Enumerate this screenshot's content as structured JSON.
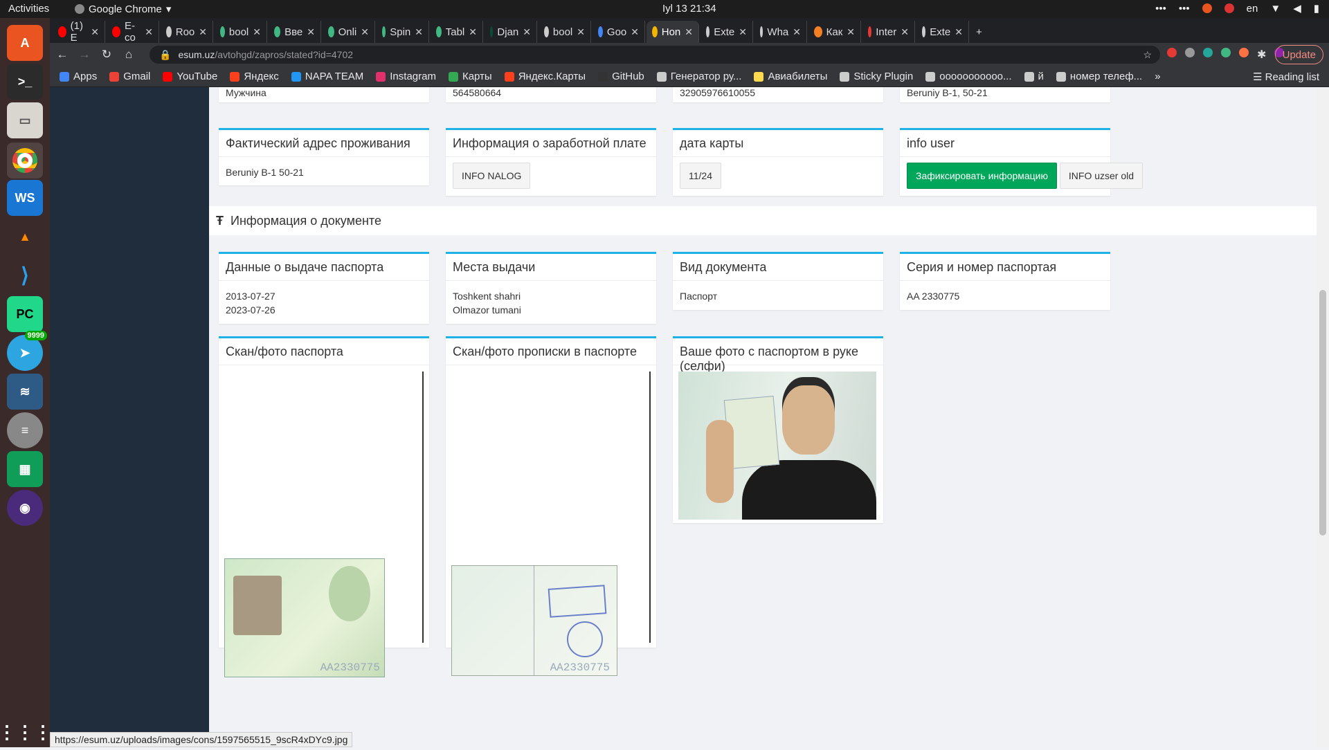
{
  "topbar": {
    "activities": "Activities",
    "app": "Google Chrome",
    "clock": "Iyl 13  21:34",
    "lang": "en"
  },
  "tabs": [
    {
      "label": "(1) E",
      "color": "#ff0000"
    },
    {
      "label": "E-co",
      "color": "#ff0000"
    },
    {
      "label": "Roo",
      "color": "#cccccc"
    },
    {
      "label": "bool",
      "color": "#41b883"
    },
    {
      "label": "Вве",
      "color": "#41b883"
    },
    {
      "label": "Onli",
      "color": "#41b883"
    },
    {
      "label": "Spin",
      "color": "#41b883"
    },
    {
      "label": "Tabl",
      "color": "#41b883"
    },
    {
      "label": "Djan",
      "color": "#0c4b33"
    },
    {
      "label": "bool",
      "color": "#cccccc"
    },
    {
      "label": "Goo",
      "color": "#4285f4"
    },
    {
      "label": "Hon",
      "color": "#f4b400"
    },
    {
      "label": "Exte",
      "color": "#cccccc"
    },
    {
      "label": "Wha",
      "color": "#cccccc"
    },
    {
      "label": "Как",
      "color": "#f48024"
    },
    {
      "label": "Inter",
      "color": "#e53935"
    },
    {
      "label": "Exte",
      "color": "#cccccc"
    }
  ],
  "address": {
    "host": "esum.uz",
    "path": "/avtohgd/zapros/stated?id=4702",
    "update": "Update"
  },
  "bookmarks": [
    {
      "label": "Apps",
      "color": "#4285f4"
    },
    {
      "label": "Gmail",
      "color": "#ea4335"
    },
    {
      "label": "YouTube",
      "color": "#ff0000"
    },
    {
      "label": "Яндекс",
      "color": "#fc3f1d"
    },
    {
      "label": "NAPA TEAM",
      "color": "#2196f3"
    },
    {
      "label": "Instagram",
      "color": "#e1306c"
    },
    {
      "label": "Карты",
      "color": "#34a853"
    },
    {
      "label": "Яндекс.Карты",
      "color": "#fc3f1d"
    },
    {
      "label": "GitHub",
      "color": "#333333"
    },
    {
      "label": "Генератор ру...",
      "color": "#cccccc"
    },
    {
      "label": "Авиабилеты",
      "color": "#ffdb4d"
    },
    {
      "label": "Sticky Plugin",
      "color": "#cccccc"
    },
    {
      "label": "ooooooooooo...",
      "color": "#cccccc"
    },
    {
      "label": "й",
      "color": "#cccccc"
    },
    {
      "label": "номер телеф...",
      "color": "#cccccc"
    }
  ],
  "reading_list": "Reading list",
  "top_partial": {
    "c1": "Мужчина",
    "c2": "564580664",
    "c3": "32905976610055",
    "c4": "Beruniy B-1, 50-21"
  },
  "row1": {
    "address": {
      "title": "Фактический адрес проживания",
      "value": "Beruniy B-1 50-21"
    },
    "salary": {
      "title": "Информация о заработной плате",
      "button": "INFO NALOG"
    },
    "card_date": {
      "title": "дата карты",
      "value": "11/24"
    },
    "info_user": {
      "title": "info user",
      "btn_fix": "Зафиксировать информацию",
      "btn_old": "INFO uzser old"
    }
  },
  "section_title": "Информация о документе",
  "row2": {
    "issue": {
      "title": "Данные о выдаче паспорта",
      "line1": "2013-07-27",
      "line2": "2023-07-26"
    },
    "place": {
      "title": "Места выдачи",
      "line1": "Toshkent shahri",
      "line2": "Olmazor tumani"
    },
    "doctype": {
      "title": "Вид документа",
      "value": "Паспорт"
    },
    "series": {
      "title": "Серия и номер паспортая",
      "value": "AA 2330775"
    }
  },
  "row3": {
    "scan": {
      "title": "Скан/фото паспорта",
      "doc_no": "AA2330775"
    },
    "propiska": {
      "title": "Скан/фото прописки в паспорте",
      "doc_no": "AA2330775"
    },
    "selfie": {
      "title": "Ваше фото с паспортом в руке (селфи)"
    }
  },
  "status_url": "https://esum.uz/uploads/images/cons/1597565515_9scR4xDYc9.jpg"
}
